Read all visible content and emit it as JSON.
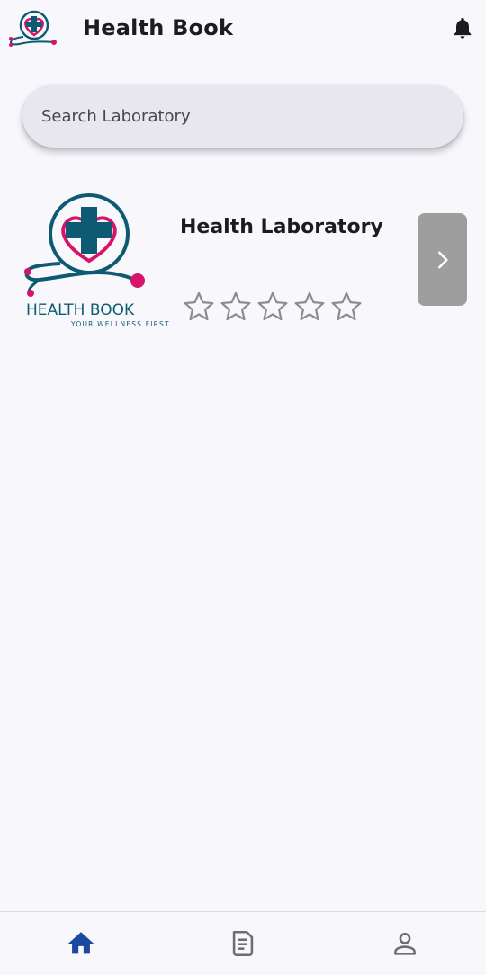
{
  "app_bar": {
    "title": "Health Book",
    "logo_icon": "health-book-logo-icon",
    "notification_icon": "bell-icon"
  },
  "search": {
    "placeholder": "Search Laboratory",
    "value": ""
  },
  "laboratories": [
    {
      "name": "Health Laboratory",
      "logo": {
        "brand": "HEALTH BOOK",
        "tagline": "YOUR WELLNESS FIRST"
      },
      "rating": 0,
      "rating_max": 5,
      "open_icon": "chevron-right-icon"
    }
  ],
  "bottom_nav": {
    "items": [
      {
        "icon": "home-icon",
        "active": true
      },
      {
        "icon": "document-icon",
        "active": false
      },
      {
        "icon": "profile-icon",
        "active": false
      }
    ]
  },
  "colors": {
    "brand_teal": "#0f5a73",
    "brand_pink": "#d6146a",
    "nav_active": "#1a4aa0",
    "nav_inactive": "#6d6d73",
    "star_outline": "#8c8c8c",
    "open_button": "#9e9e9e"
  }
}
